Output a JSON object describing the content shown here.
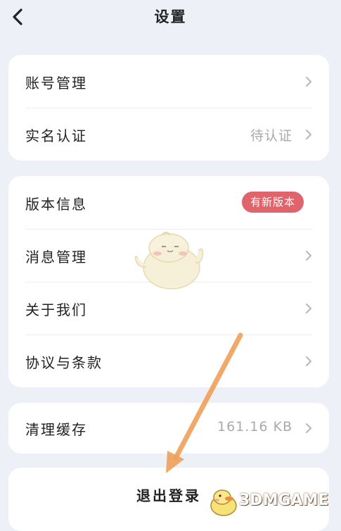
{
  "header": {
    "title": "设置"
  },
  "cards": {
    "account": [
      {
        "label": "账号管理",
        "value": ""
      },
      {
        "label": "实名认证",
        "value": "待认证"
      }
    ],
    "info": [
      {
        "label": "版本信息",
        "badge": "有新版本"
      },
      {
        "label": "消息管理"
      },
      {
        "label": "关于我们"
      },
      {
        "label": "协议与条款"
      }
    ],
    "cache": {
      "label": "清理缓存",
      "value": "161.16 KB"
    },
    "logout": {
      "label": "退出登录"
    }
  },
  "watermark": {
    "text": "3DMGAME"
  },
  "colors": {
    "background": "#eef0f8",
    "badge": "#e0646b",
    "arrow": "#f0a05a"
  }
}
